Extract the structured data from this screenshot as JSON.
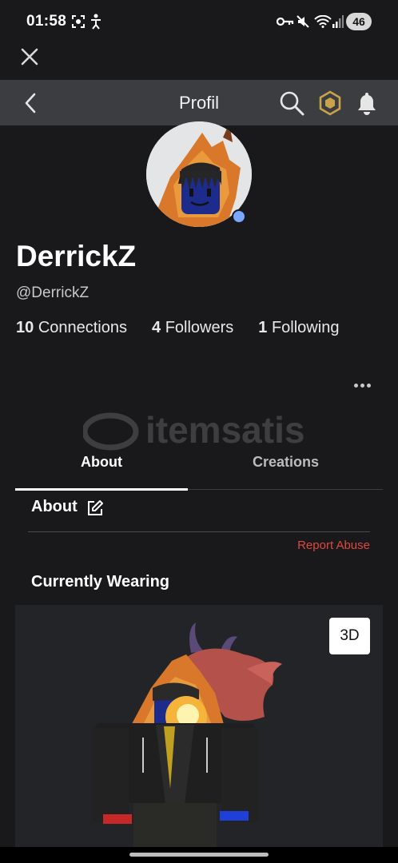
{
  "status_bar": {
    "time": "01:58",
    "icons": [
      "screenshot-icon",
      "accessibility-icon",
      "key-icon",
      "mute-icon",
      "wifi-icon",
      "signal-icon"
    ],
    "battery": "46"
  },
  "header": {
    "title": "Profil",
    "icons": [
      "close-icon",
      "back-icon",
      "search-icon",
      "robux-icon",
      "bell-icon"
    ]
  },
  "profile": {
    "display_name": "DerrickZ",
    "username": "@DerrickZ",
    "online_status_color": "#7aa7ff",
    "stats": {
      "connections_count": "10",
      "connections_label": "Connections",
      "followers_count": "4",
      "followers_label": "Followers",
      "following_count": "1",
      "following_label": "Following"
    }
  },
  "tabs": {
    "about": "About",
    "creations": "Creations",
    "active": "About"
  },
  "about": {
    "title": "About",
    "report_label": "Report Abuse"
  },
  "wearing": {
    "title": "Currently Wearing",
    "view_3d_label": "3D"
  },
  "watermark": {
    "text": "itemsatis"
  },
  "colors": {
    "background": "#19191c",
    "header": "#3b3d41",
    "report": "#e0473f",
    "accent_gold": "#c9a24a"
  }
}
